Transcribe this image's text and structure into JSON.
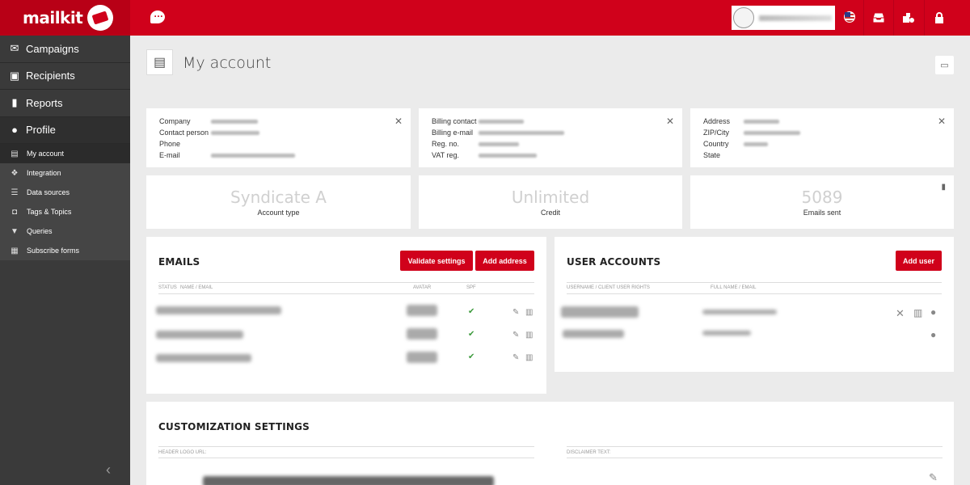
{
  "app": {
    "logo": "mailkit"
  },
  "sidebar": {
    "items": [
      {
        "label": "Campaigns",
        "icon": "envelope-icon"
      },
      {
        "label": "Recipients",
        "icon": "contact-card-icon"
      },
      {
        "label": "Reports",
        "icon": "bar-chart-icon"
      },
      {
        "label": "Profile",
        "icon": "user-icon"
      }
    ],
    "subitems": [
      {
        "label": "My account",
        "icon": "id-badge-icon"
      },
      {
        "label": "Integration",
        "icon": "integration-icon"
      },
      {
        "label": "Data sources",
        "icon": "database-icon"
      },
      {
        "label": "Tags & Topics",
        "icon": "tag-icon"
      },
      {
        "label": "Queries",
        "icon": "filter-icon"
      },
      {
        "label": "Subscribe forms",
        "icon": "form-icon"
      }
    ]
  },
  "page": {
    "title": "My account"
  },
  "company_card": {
    "labels": [
      "Company",
      "Contact person",
      "Phone",
      "E-mail"
    ]
  },
  "billing_card": {
    "labels": [
      "Billing contact",
      "Billing e-mail",
      "Reg. no.",
      "VAT reg."
    ]
  },
  "address_card": {
    "labels": [
      "Address",
      "ZIP/City",
      "Country",
      "State"
    ]
  },
  "stats": [
    {
      "value": "Syndicate A",
      "label": "Account type"
    },
    {
      "value": "Unlimited",
      "label": "Credit"
    },
    {
      "value": "5089",
      "label": "Emails sent"
    }
  ],
  "emails": {
    "title": "EMAILS",
    "validate_label": "Validate settings",
    "add_label": "Add address",
    "headers": {
      "status": "STATUS",
      "name": "NAME / EMAIL",
      "avatar": "AVATAR",
      "spf": "SPF"
    }
  },
  "users": {
    "title": "USER ACCOUNTS",
    "add_label": "Add user",
    "headers": {
      "username": "USERNAME / CLIENT USER RIGHTS",
      "fullname": "FULL NAME / EMAIL"
    }
  },
  "customization": {
    "title": "CUSTOMIZATION SETTINGS",
    "logo_label": "HEADER LOGO URL:",
    "disclaimer_label": "DISCLAIMER TEXT:"
  }
}
